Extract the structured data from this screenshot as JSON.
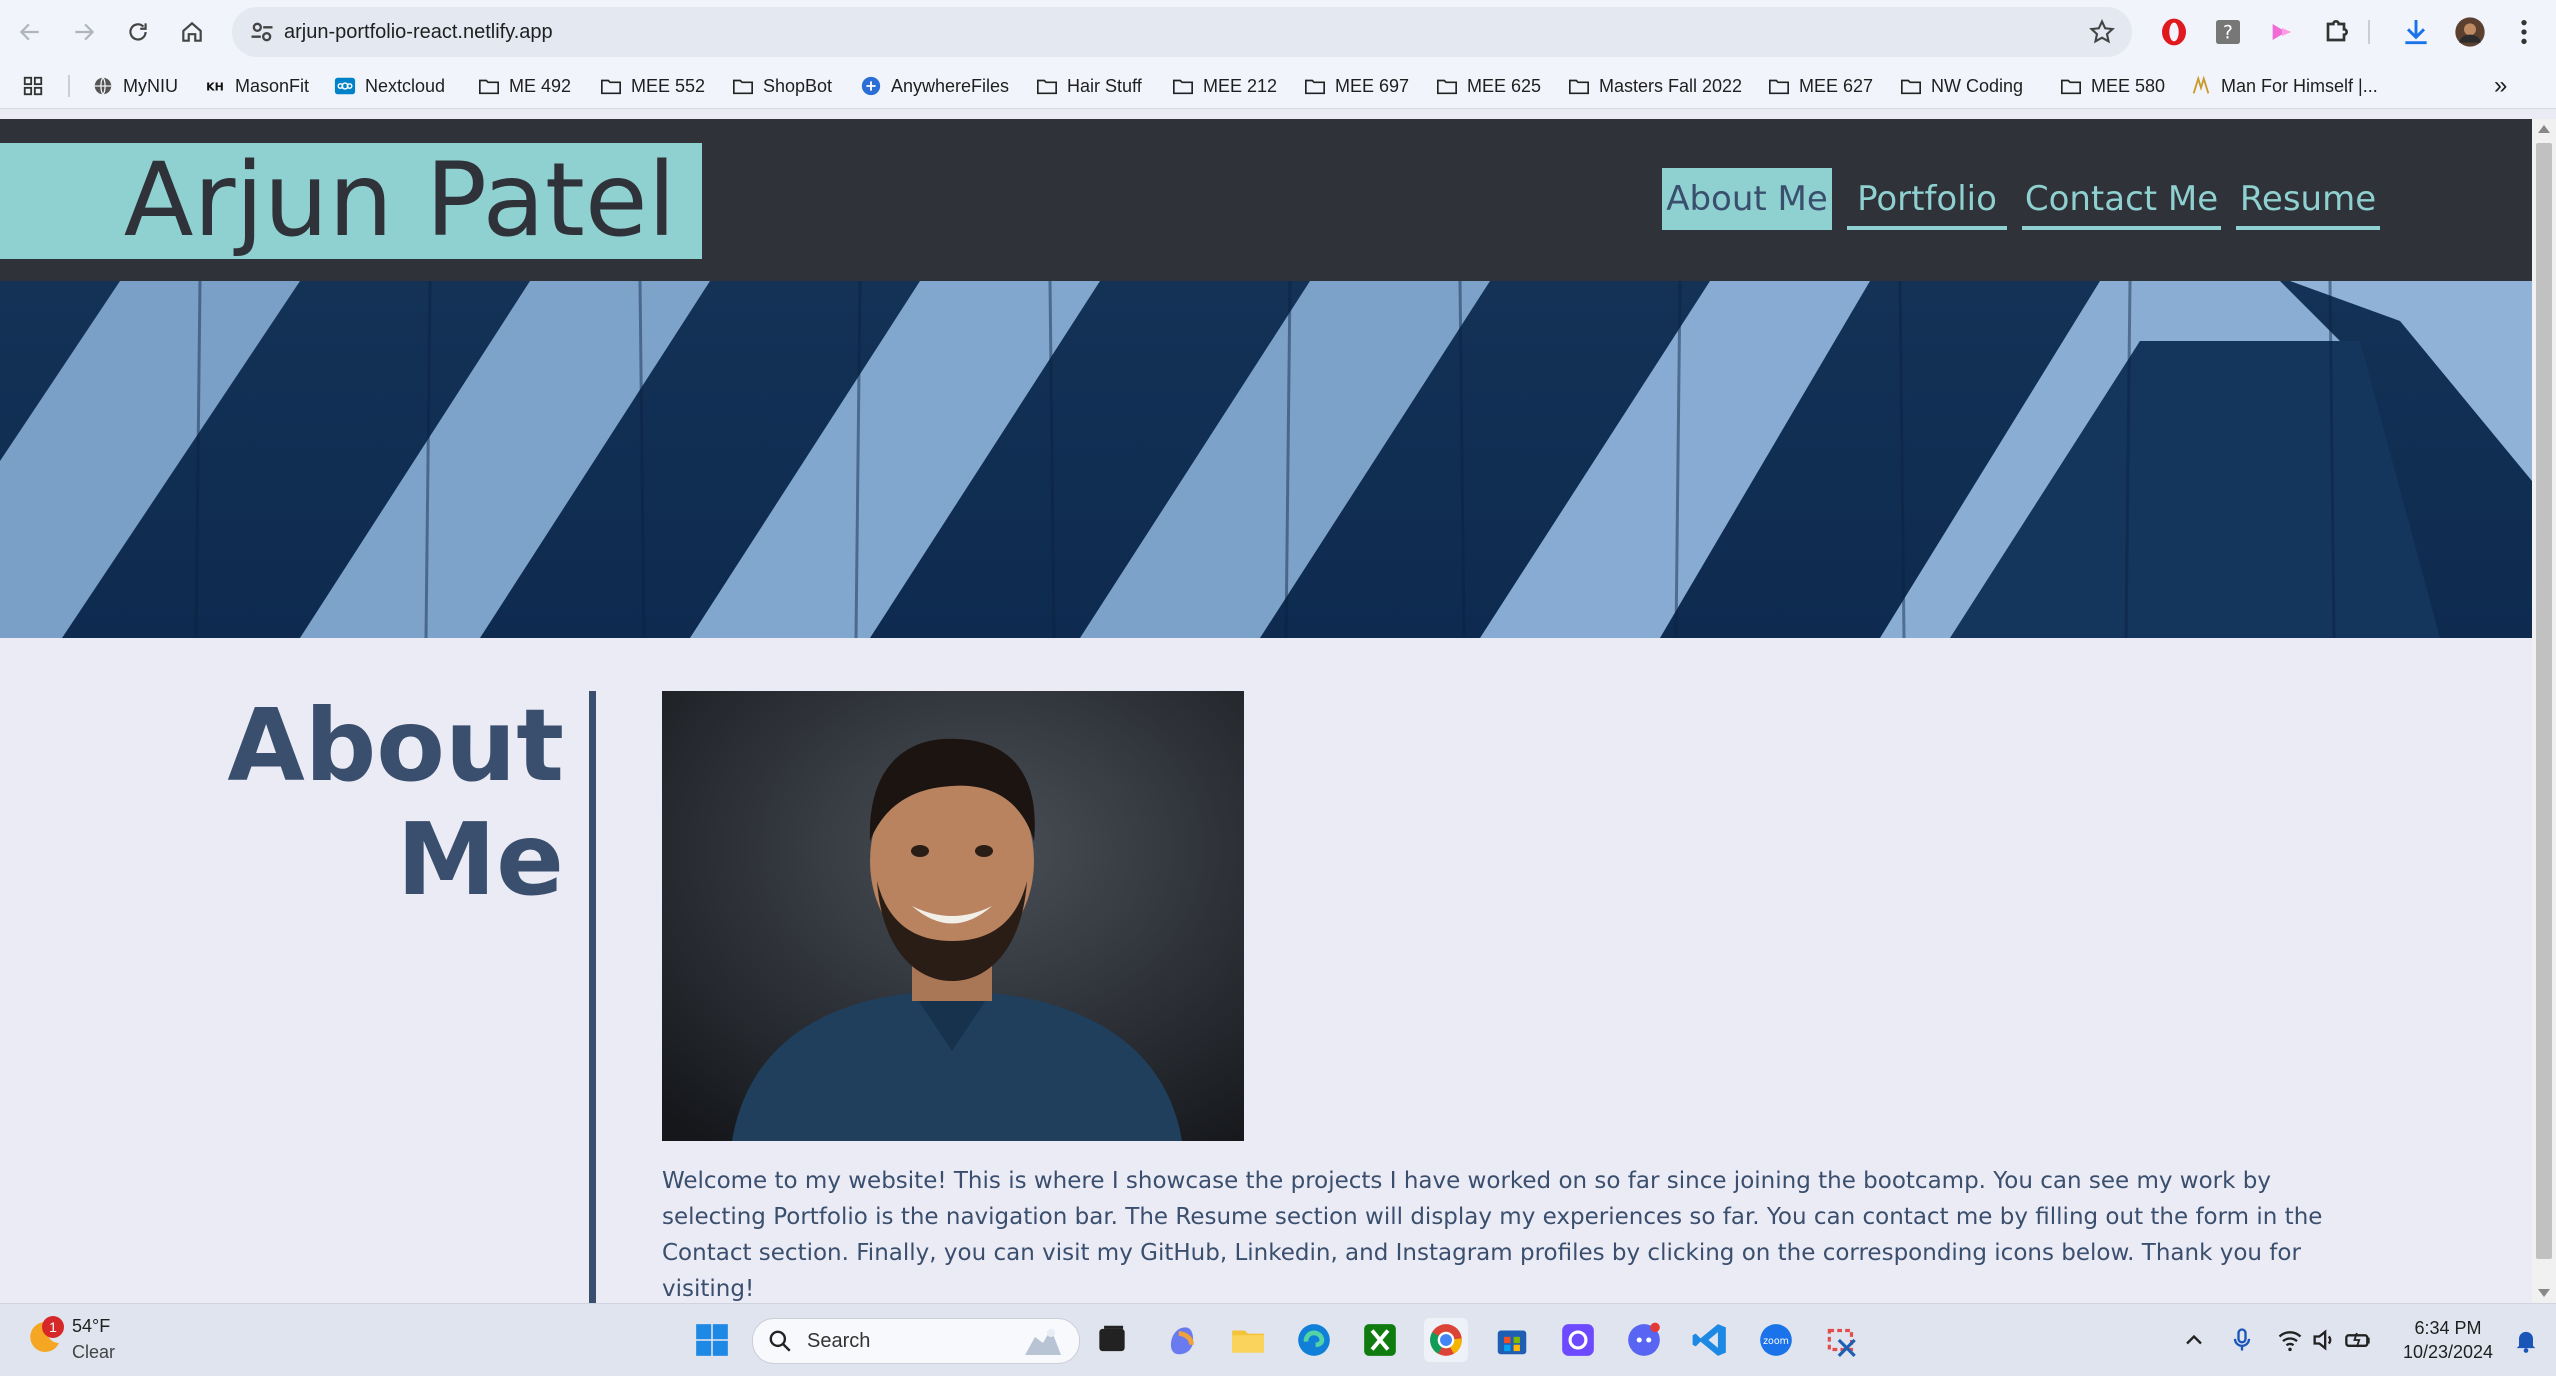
{
  "browser": {
    "url": "arjun-portfolio-react.netlify.app",
    "bookmarks": [
      {
        "label": "MyNIU",
        "icon": "globe-icon"
      },
      {
        "label": "MasonFit",
        "icon": "kh-icon"
      },
      {
        "label": "Nextcloud",
        "icon": "nextcloud-icon"
      },
      {
        "label": "ME 492",
        "icon": "folder-icon"
      },
      {
        "label": "MEE 552",
        "icon": "folder-icon"
      },
      {
        "label": "ShopBot",
        "icon": "folder-icon"
      },
      {
        "label": "AnywhereFiles",
        "icon": "anywherefiles-icon"
      },
      {
        "label": "Hair Stuff",
        "icon": "folder-icon"
      },
      {
        "label": "MEE 212",
        "icon": "folder-icon"
      },
      {
        "label": "MEE 697",
        "icon": "folder-icon"
      },
      {
        "label": "MEE 625",
        "icon": "folder-icon"
      },
      {
        "label": "Masters Fall 2022",
        "icon": "folder-icon"
      },
      {
        "label": "MEE 627",
        "icon": "folder-icon"
      },
      {
        "label": "NW Coding",
        "icon": "folder-icon"
      },
      {
        "label": "MEE 580",
        "icon": "folder-icon"
      },
      {
        "label": "Man For Himself |...",
        "icon": "book-icon"
      }
    ],
    "more_bookmarks": "»"
  },
  "site": {
    "name": "Arjun Patel",
    "nav": [
      {
        "label": "About Me",
        "active": true
      },
      {
        "label": "Portfolio",
        "active": false
      },
      {
        "label": "Contact Me",
        "active": false
      },
      {
        "label": "Resume",
        "active": false
      }
    ],
    "about": {
      "title_line1": "About",
      "title_line2": "Me",
      "bio": "Welcome to my website! This is where I showcase the projects I have worked on so far since joining the bootcamp. You can see my work by selecting Portfolio is the navigation bar. The Resume section will display my experiences so far. You can contact me by filling out the form in the Contact section. Finally, you can visit my GitHub, Linkedin, and Instagram profiles by clicking on the corresponding icons below. Thank you for visiting!"
    },
    "colors": {
      "header_bg": "#2f3239",
      "accent": "#8fd0d0",
      "text": "#3a4f6e",
      "page_bg": "#ebebf5"
    }
  },
  "taskbar": {
    "weather_temp": "54°F",
    "weather_condition": "Clear",
    "weather_badge": "1",
    "search_placeholder": "Search",
    "time": "6:34 PM",
    "date": "10/23/2024"
  }
}
